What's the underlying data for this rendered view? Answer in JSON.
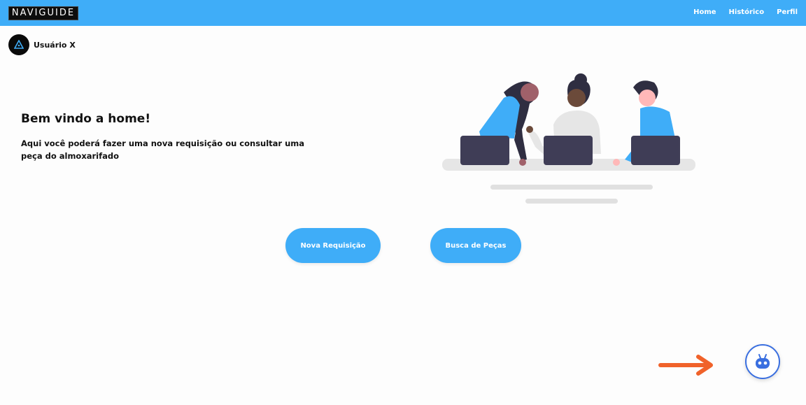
{
  "header": {
    "logo_text": "NAVIGUIDE",
    "nav": [
      {
        "label": "Home"
      },
      {
        "label": "Histórico"
      },
      {
        "label": "Perfil"
      }
    ]
  },
  "user": {
    "name": "Usuário X",
    "avatar_icon": "triangle-logo-icon"
  },
  "welcome": {
    "title": "Bem vindo a home!",
    "text": "Aqui você poderá fazer uma nova requisição ou consultar uma peça do almoxarifado"
  },
  "actions": {
    "nova_label": "Nova Requisição",
    "busca_label": "Busca de Peças"
  },
  "chatbot": {
    "icon": "robot-icon"
  },
  "colors": {
    "primary": "#3fadf8",
    "arrow": "#f0622a",
    "chatbot_border": "#3a6fe0"
  }
}
